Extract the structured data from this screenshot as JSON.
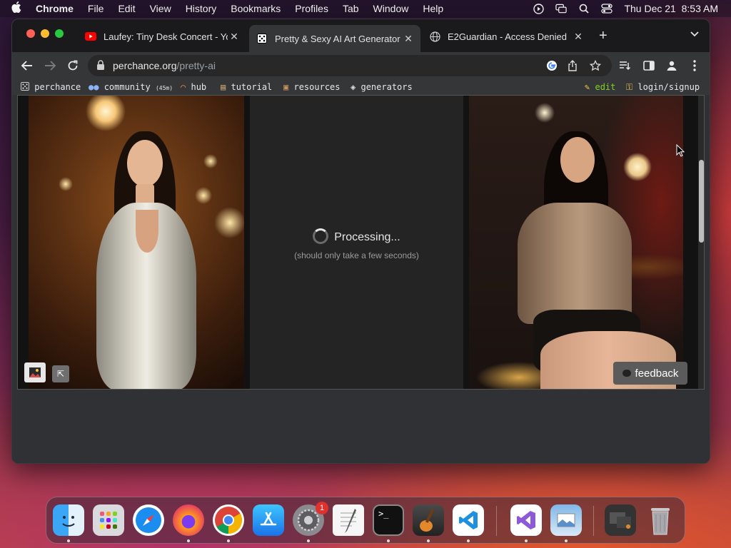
{
  "menubar": {
    "app": "Chrome",
    "items": [
      "File",
      "Edit",
      "View",
      "History",
      "Bookmarks",
      "Profiles",
      "Tab",
      "Window",
      "Help"
    ],
    "clock": "Thu Dec 21  8:53 AM"
  },
  "tabs": [
    {
      "title": "Laufey: Tiny Desk Concert - Yo",
      "icon": "youtube-icon"
    },
    {
      "title": "Pretty & Sexy AI Art Generator",
      "icon": "perchance-dice-icon",
      "active": true
    },
    {
      "title": "E2Guardian - Access Denied",
      "icon": "globe-icon"
    }
  ],
  "omnibox": {
    "domain": "perchance.org",
    "path": "/pretty-ai"
  },
  "bookmarks": {
    "perchance": "perchance",
    "community": "community",
    "community_count": "(45m)",
    "hub": "hub",
    "tutorial": "tutorial",
    "resources": "resources",
    "generators": "generators",
    "edit": "edit",
    "login": "login/signup"
  },
  "content": {
    "processing": "Processing...",
    "note": "(should only take a few seconds)",
    "feedback": "feedback"
  },
  "dock": {
    "apps": [
      "Finder",
      "Launchpad",
      "Safari",
      "Firefox",
      "Chrome",
      "App Store",
      "System Settings",
      "TextEdit",
      "Terminal",
      "GarageBand",
      "Visual Studio Code",
      "Visual Studio",
      "Preview",
      "Downloads",
      "Trash"
    ],
    "settings_badge": "1"
  },
  "colors": {
    "accent_edit": "#7ed321",
    "badge": "#e0312c"
  }
}
